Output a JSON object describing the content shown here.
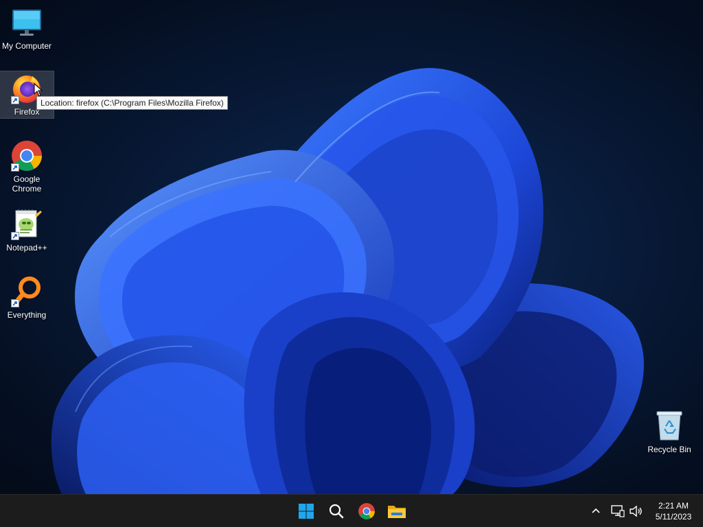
{
  "desktop": {
    "icons": [
      {
        "id": "my-computer",
        "label": "My Computer",
        "icon": "monitor-icon",
        "shortcut": false
      },
      {
        "id": "firefox",
        "label": "Firefox",
        "icon": "firefox-icon",
        "shortcut": true,
        "selected": true
      },
      {
        "id": "google-chrome",
        "label": "Google Chrome",
        "icon": "chrome-icon",
        "shortcut": true
      },
      {
        "id": "notepadpp",
        "label": "Notepad++",
        "icon": "notepadpp-icon",
        "shortcut": true
      },
      {
        "id": "everything",
        "label": "Everything",
        "icon": "everything-icon",
        "shortcut": true
      },
      {
        "id": "recycle-bin",
        "label": "Recycle Bin",
        "icon": "recycle-bin-icon",
        "shortcut": false
      }
    ],
    "tooltip": "Location: firefox (C:\\Program Files\\Mozilla Firefox)"
  },
  "taskbar": {
    "buttons": [
      {
        "id": "start",
        "icon": "windows-start-icon"
      },
      {
        "id": "search",
        "icon": "search-icon"
      },
      {
        "id": "chrome",
        "icon": "chrome-icon"
      },
      {
        "id": "file-explorer",
        "icon": "folder-icon"
      }
    ],
    "tray": {
      "icons": [
        "chevron-up-icon",
        "network-icon",
        "volume-icon"
      ],
      "time": "2:21 AM",
      "date": "5/11/2023"
    }
  },
  "colors": {
    "taskbar_bg": "#1c1c1c",
    "wallpaper_dark": "#061330",
    "wallpaper_bloom": "#1e4fe0",
    "windows_blue": "#1fa6ee"
  }
}
